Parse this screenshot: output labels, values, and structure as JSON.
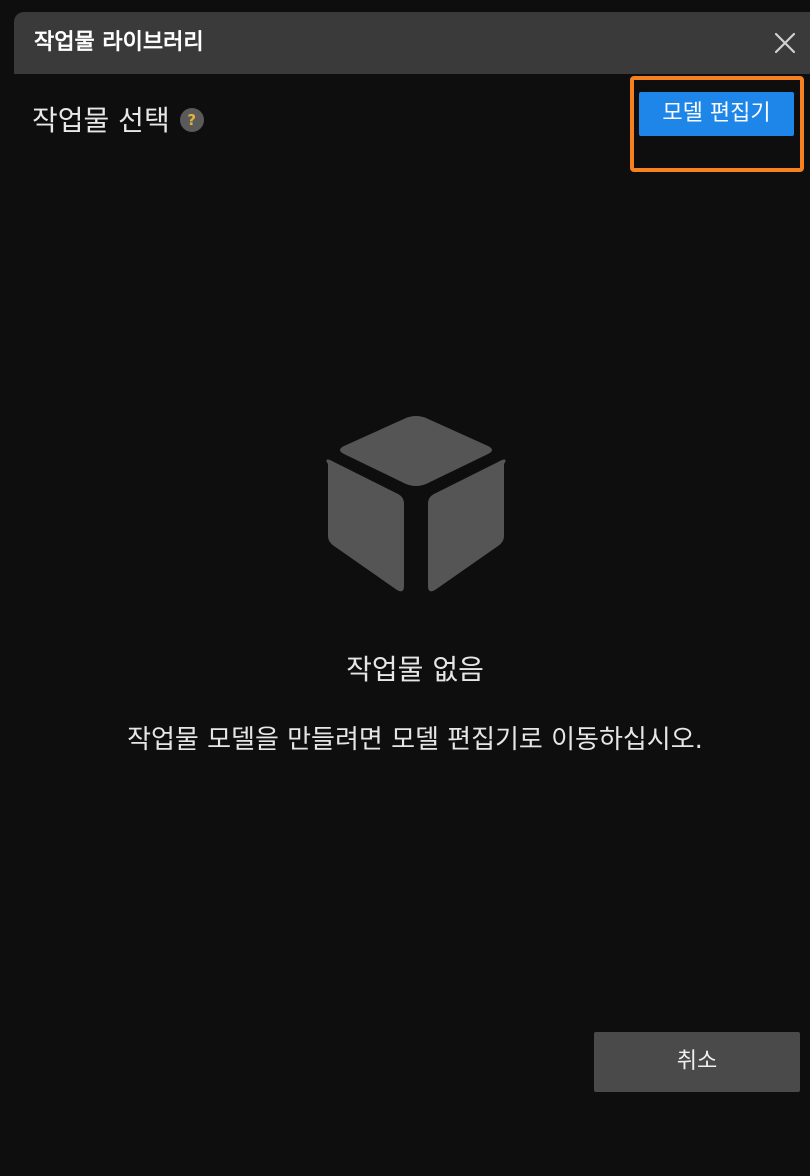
{
  "window": {
    "title": "작업물 라이브러리",
    "close_icon": "close-icon"
  },
  "header": {
    "section_title": "작업물 선택",
    "help_icon_symbol": "?",
    "model_editor_label": "모델 편집기"
  },
  "empty_state": {
    "icon": "cube-icon",
    "title": "작업물 없음",
    "description": "작업물 모델을 만들려면 모델 편집기로 이동하십시오."
  },
  "footer": {
    "cancel_label": "취소"
  },
  "colors": {
    "background": "#0e0e0e",
    "titlebar": "#3a3a3a",
    "accent_blue": "#1d86e8",
    "highlight_orange": "#f5821f",
    "cube_gray": "#555555",
    "button_gray": "#4a4a4a",
    "help_icon_mark": "#e2b33a"
  }
}
